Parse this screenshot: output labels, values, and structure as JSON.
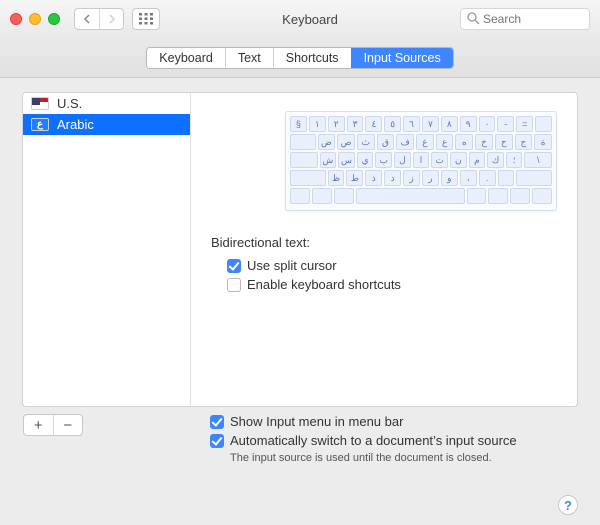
{
  "window": {
    "title": "Keyboard",
    "search_placeholder": "Search"
  },
  "tabs": [
    {
      "label": "Keyboard",
      "selected": false
    },
    {
      "label": "Text",
      "selected": false
    },
    {
      "label": "Shortcuts",
      "selected": false
    },
    {
      "label": "Input Sources",
      "selected": true
    }
  ],
  "sources": [
    {
      "label": "U.S.",
      "flag": "us",
      "selected": false
    },
    {
      "label": "Arabic",
      "flag": "ar",
      "selected": true,
      "flag_glyph": "ع"
    }
  ],
  "keyboard_rows": [
    [
      "§",
      "١",
      "٢",
      "٣",
      "٤",
      "٥",
      "٦",
      "٧",
      "٨",
      "٩",
      "٠",
      "-",
      "="
    ],
    [
      "",
      "ض",
      "ص",
      "ث",
      "ق",
      "ف",
      "غ",
      "ع",
      "ه",
      "خ",
      "ح",
      "ج",
      "ة"
    ],
    [
      "",
      "ش",
      "س",
      "ي",
      "ب",
      "ل",
      "ا",
      "ت",
      "ن",
      "م",
      "ك",
      "؛",
      "\\"
    ],
    [
      "",
      "ظ",
      "ط",
      "ذ",
      "د",
      "ز",
      "ر",
      "و",
      "،",
      ".",
      "",
      ""
    ],
    [
      "",
      "",
      "",
      "",
      "",
      "",
      "",
      ""
    ]
  ],
  "bidi": {
    "section_label": "Bidirectional text:",
    "use_split_cursor": {
      "label": "Use split cursor",
      "checked": true
    },
    "enable_shortcuts": {
      "label": "Enable keyboard shortcuts",
      "checked": false
    }
  },
  "footer": {
    "show_menu": {
      "label": "Show Input menu in menu bar",
      "checked": true
    },
    "auto_switch": {
      "label": "Automatically switch to a document’s input source",
      "checked": true
    },
    "hint": "The input source is used until the document is closed."
  },
  "buttons": {
    "add": "+",
    "remove": "−",
    "help": "?"
  }
}
